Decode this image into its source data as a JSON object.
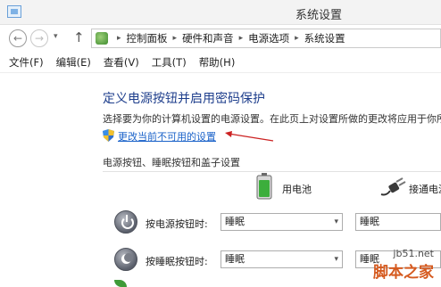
{
  "window": {
    "title": "系统设置"
  },
  "nav": {
    "back": "←",
    "forward": "→",
    "recent": "▾",
    "up": "↑"
  },
  "address": {
    "crumbs": [
      "控制面板",
      "硬件和声音",
      "电源选项",
      "系统设置"
    ],
    "separator": "▸"
  },
  "menu": {
    "items": [
      "文件(F)",
      "编辑(E)",
      "查看(V)",
      "工具(T)",
      "帮助(H)"
    ]
  },
  "content": {
    "heading": "定义电源按钮并启用密码保护",
    "description": "选择要为你的计算机设置的电源设置。在此页上对设置所做的更改将应用于你所",
    "change_link": "更改当前不可用的设置",
    "section_label": "电源按钮、睡眠按钮和盖子设置",
    "columns": {
      "battery": "用电池",
      "plugged": "接通电源"
    },
    "rows": [
      {
        "label": "按电源按钮时:",
        "battery_value": "睡眠",
        "plugged_value": "睡眠"
      },
      {
        "label": "按睡眠按钮时:",
        "battery_value": "睡眠",
        "plugged_value": "睡眠"
      }
    ]
  },
  "watermark": {
    "url": "jb51.net",
    "name": "脚本之家"
  },
  "colors": {
    "heading": "#1e3e8c",
    "link": "#1a62c9",
    "arrow": "#cc2222",
    "watermark": "#d55a1f"
  }
}
